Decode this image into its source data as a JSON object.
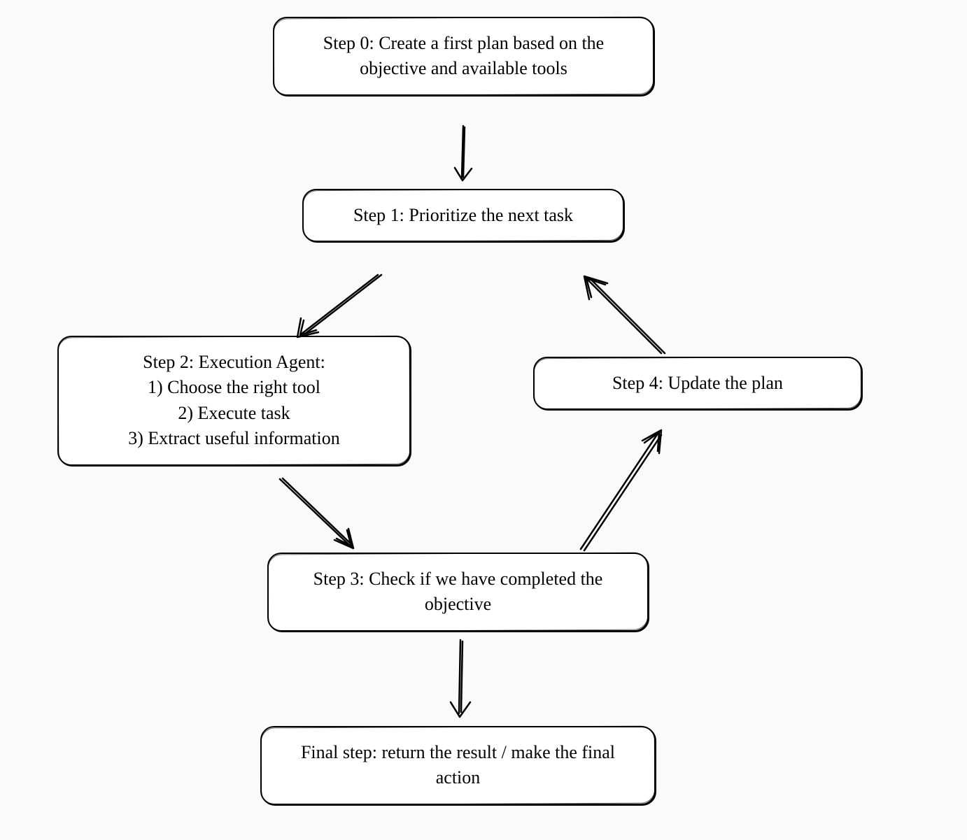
{
  "nodes": {
    "step0": "Step 0: Create a first plan based on the objective and available tools",
    "step1": "Step 1: Prioritize the next task",
    "step2": "Step 2: Execution Agent:\n1) Choose the right tool\n2) Execute task\n3) Extract useful information",
    "step3": "Step 3: Check if we have completed the objective",
    "step4": "Step 4: Update the plan",
    "final": "Final step: return the result / make the final action"
  },
  "edges": [
    {
      "from": "step0",
      "to": "step1"
    },
    {
      "from": "step1",
      "to": "step2"
    },
    {
      "from": "step2",
      "to": "step3"
    },
    {
      "from": "step3",
      "to": "step4"
    },
    {
      "from": "step4",
      "to": "step1"
    },
    {
      "from": "step3",
      "to": "final"
    }
  ],
  "style": {
    "hand_drawn": true,
    "font": "handwritten",
    "background": "#fafafa",
    "node_fill": "#ffffff",
    "stroke": "#000000"
  }
}
